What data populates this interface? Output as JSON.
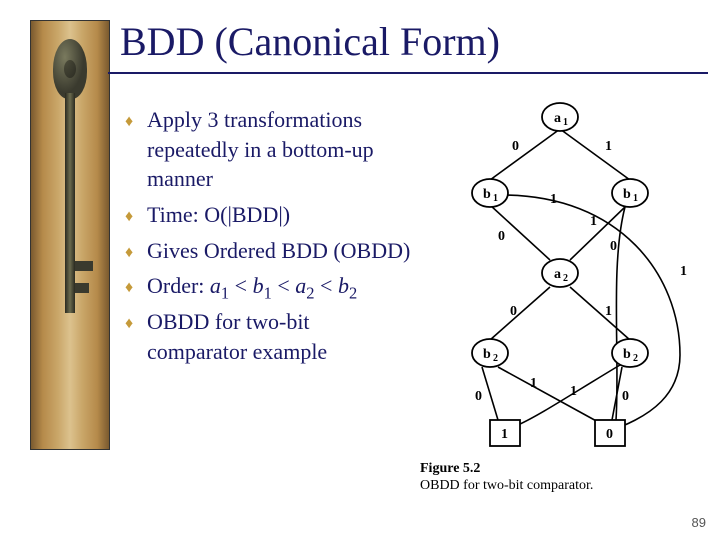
{
  "title": "BDD (Canonical Form)",
  "bullets": {
    "b1": "Apply 3 transformations repeatedly in a bottom-up manner",
    "b2": "Time: O(|BDD|)",
    "b3": "Gives Ordered BDD (OBDD)",
    "b4_prefix": "Order: ",
    "b4_a1": "a",
    "b4_s1": "1",
    "b4_lt1": " < ",
    "b4_b1": "b",
    "b4_s2": "1",
    "b4_lt2": " < ",
    "b4_a2": "a",
    "b4_s3": "2",
    "b4_lt3": " < ",
    "b4_b2": "b",
    "b4_s4": "2",
    "b5": "OBDD for two-bit comparator example"
  },
  "bullet_glyph": "♦",
  "page_number": "89",
  "diagram": {
    "caption_num": "Figure 5.2",
    "caption_text": "OBDD for two-bit comparator.",
    "nodes": {
      "a1": "a",
      "a1s": "1",
      "b1L": "b",
      "b1Ls": "1",
      "b1R": "b",
      "b1Rs": "1",
      "a2": "a",
      "a2s": "2",
      "b2L": "b",
      "b2Ls": "2",
      "b2R": "b",
      "b2Rs": "2",
      "t1": "1",
      "t0": "0"
    },
    "edge_labels": {
      "a1_b1L": "0",
      "a1_b1R": "1",
      "b1L_a2": "0",
      "b1L_zero": "1",
      "b1R_zero": "0",
      "b1R_a2": "1",
      "a2_b2L": "0",
      "a2_b2R": "1",
      "b2L_one": "0",
      "b2L_zero": "1",
      "b2R_zero": "0",
      "b2R_one": "1"
    }
  },
  "sidebar": {
    "name": "antique-key-image"
  }
}
